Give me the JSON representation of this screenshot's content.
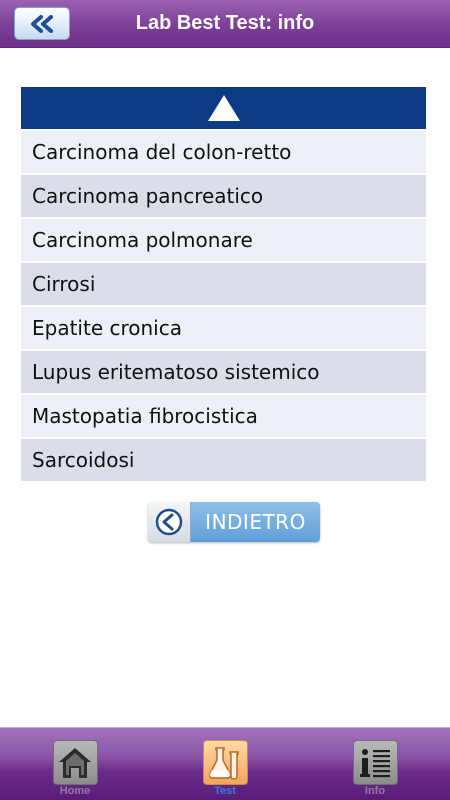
{
  "header": {
    "title": "Lab Best Test: info",
    "back_icon": "double-chevron-left-icon"
  },
  "list": {
    "header_icon": "triangle-up-icon",
    "items": [
      {
        "label": "Carcinoma del colon-retto"
      },
      {
        "label": "Carcinoma pancreatico"
      },
      {
        "label": "Carcinoma polmonare"
      },
      {
        "label": "Cirrosi"
      },
      {
        "label": "Epatite cronica"
      },
      {
        "label": "Lupus eritematoso sistemico"
      },
      {
        "label": "Mastopatia fibrocistica"
      },
      {
        "label": "Sarcoidosi"
      }
    ]
  },
  "indietro": {
    "label": "INDIETRO",
    "icon": "circle-arrow-left-icon"
  },
  "tabbar": {
    "tabs": [
      {
        "label": "Home",
        "icon": "house-icon",
        "active": false
      },
      {
        "label": "Test",
        "icon": "flask-icon",
        "active": true
      },
      {
        "label": "Info",
        "icon": "info-document-icon",
        "active": false
      }
    ]
  },
  "colors": {
    "header_purple": "#7c3f98",
    "list_header_blue": "#0b3a86",
    "row_light": "#eef0f7",
    "row_dark": "#dbdde9",
    "active_tab_label": "#2f7fe0"
  }
}
